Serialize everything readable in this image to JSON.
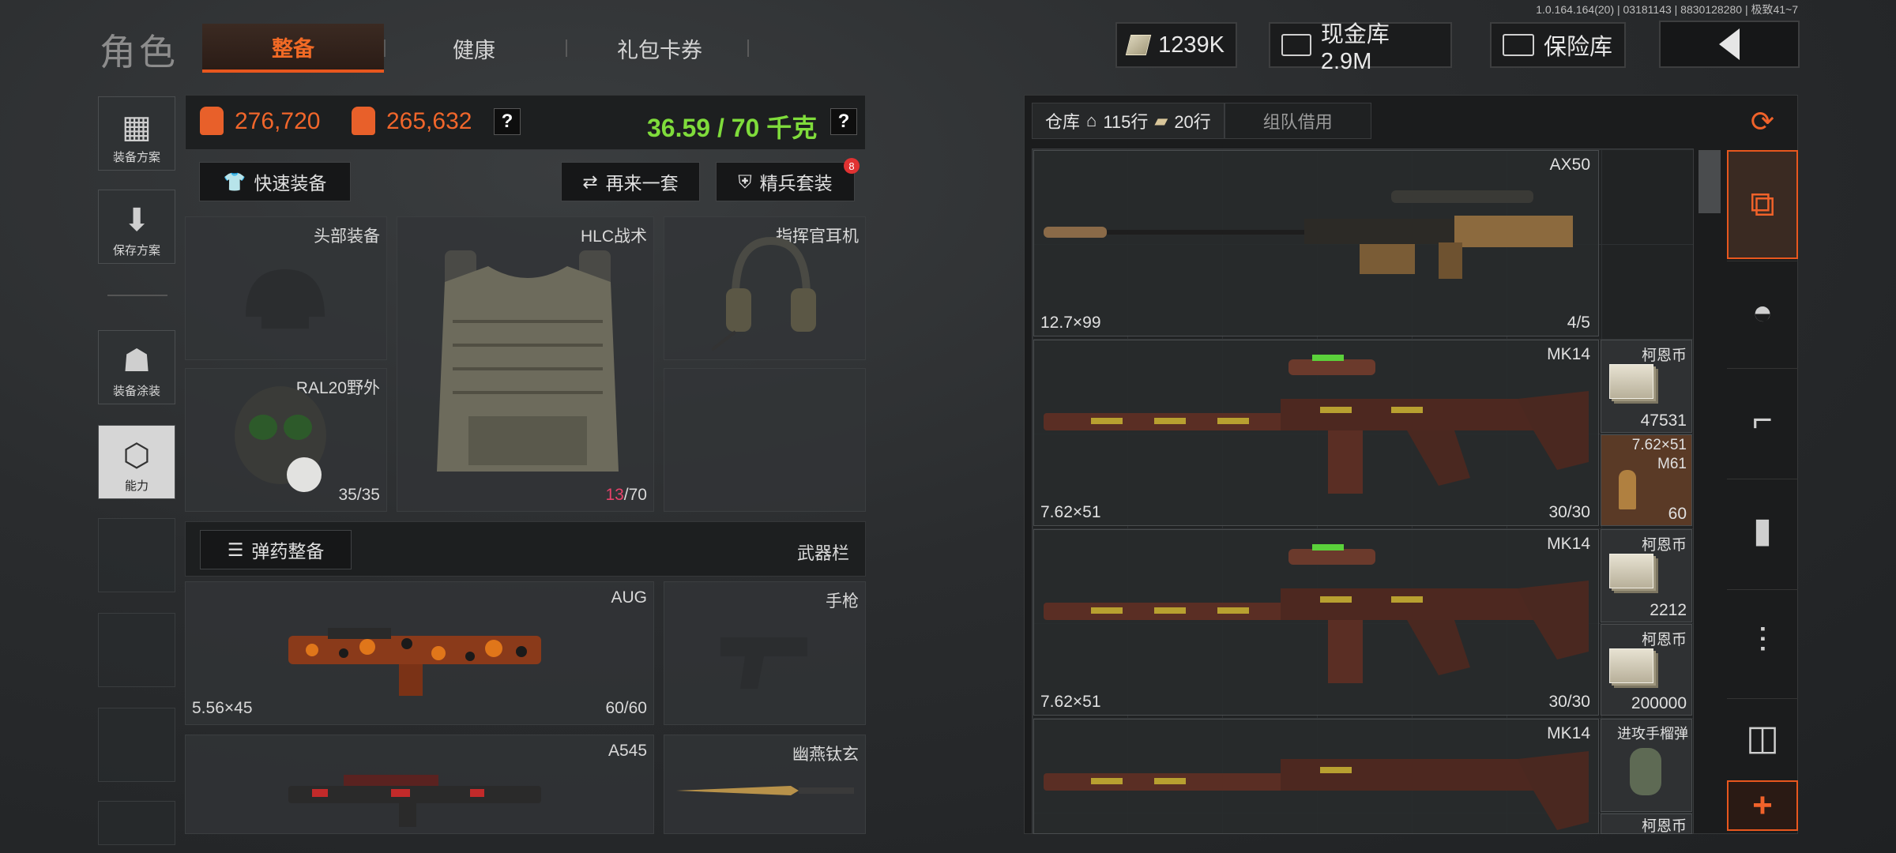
{
  "version": "1.0.164.164(20) | 03181143 | 8830128280 | 极致41~7",
  "header": {
    "title": "角色",
    "tabs": [
      {
        "label": "整备",
        "active": true
      },
      {
        "label": "健康",
        "active": false
      },
      {
        "label": "礼包卡券",
        "active": false
      }
    ],
    "cash": "1239K",
    "vault_label": "现金库 2.9M",
    "safe_label": "保险库"
  },
  "sidebar": {
    "items": [
      {
        "label": "装备方案",
        "icon": "vest-icon"
      },
      {
        "label": "保存方案",
        "icon": "download-icon"
      },
      {
        "label": "装备涂装",
        "icon": "paint-icon"
      },
      {
        "label": "能力",
        "icon": "ability-icon"
      }
    ]
  },
  "equip": {
    "value1": "276,720",
    "value2": "265,632",
    "weight": "36.59 / 70 千克",
    "help": "?",
    "quick_equip": "快速装备",
    "another_set": "再来一套",
    "elite_set": "精兵套装",
    "elite_badge": "8",
    "slots": {
      "head": "头部装备",
      "armor": "HLC战术",
      "armor_dura": "13",
      "armor_max": "/70",
      "headset": "指挥官耳机",
      "mask": "RAL20野外",
      "mask_dura": "35/35"
    },
    "ammo_button": "弹药整备",
    "weapon_bar": "武器栏",
    "weapons": {
      "primary_name": "AUG",
      "primary_caliber": "5.56×45",
      "primary_ammo": "60/60",
      "pistol": "手枪",
      "secondary_name": "A545",
      "melee_name": "幽燕钛玄"
    }
  },
  "warehouse": {
    "tab_label": "仓库",
    "rows": "115行",
    "tickets": "20行",
    "team_borrow": "组队借用",
    "cards": [
      {
        "name": "AX50",
        "caliber": "12.7×99",
        "ammo": "4/5"
      },
      {
        "name": "MK14",
        "caliber": "7.62×51",
        "ammo": "30/30"
      },
      {
        "name": "MK14",
        "caliber": "7.62×51",
        "ammo": "30/30"
      },
      {
        "name": "MK14",
        "caliber": "",
        "ammo": ""
      }
    ],
    "side_items": [
      {
        "name": "柯恩币",
        "value": "47531"
      },
      {
        "name": "7.62×51",
        "sub": "M61",
        "value": "60"
      },
      {
        "name": "柯恩币",
        "value": "2212"
      },
      {
        "name": "柯恩币",
        "value": "200000"
      },
      {
        "name": "进攻手榴弹",
        "value": ""
      },
      {
        "name": "柯恩币",
        "value": ""
      }
    ]
  },
  "categories": [
    "refresh-icon",
    "stack-icon",
    "helmet-icon",
    "rifle-icon",
    "magazine-icon",
    "bullet-icon",
    "scope-icon"
  ],
  "add_label": "+",
  "colors": {
    "accent": "#e8571e",
    "weight_green": "#7fdc3b",
    "durability_pink": "#e8426a"
  }
}
